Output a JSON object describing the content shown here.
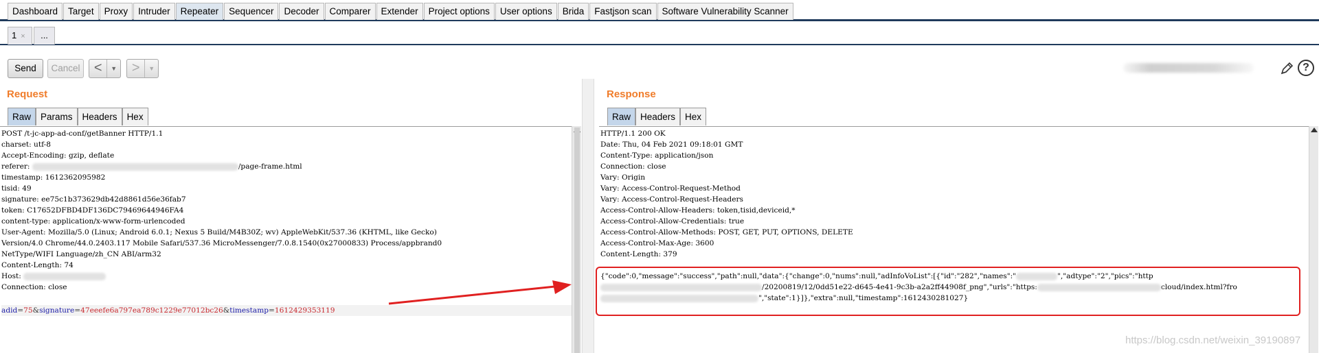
{
  "top_tabs": [
    "Dashboard",
    "Target",
    "Proxy",
    "Intruder",
    "Repeater",
    "Sequencer",
    "Decoder",
    "Comparer",
    "Extender",
    "Project options",
    "User options",
    "Brida",
    "Fastjson scan",
    "Software Vulnerability Scanner"
  ],
  "active_top_tab": "Repeater",
  "sub_tabs": {
    "tab1": "1",
    "close": "×",
    "more": "..."
  },
  "toolbar": {
    "send": "Send",
    "cancel": "Cancel",
    "back": "<",
    "forward": ">",
    "dropdown": "▼",
    "help": "?"
  },
  "request": {
    "title": "Request",
    "tabs": [
      "Raw",
      "Params",
      "Headers",
      "Hex"
    ],
    "lines": [
      "POST /t-jc-app-ad-conf/getBanner HTTP/1.1",
      "charset: utf-8",
      "Accept-Encoding: gzip, deflate",
      "referer: ",
      "timestamp: 1612362095982",
      "tisid: 49",
      "signature: ee75c1b373629db42d8861d56e36fab7",
      "token: C17652DFBD4DF136DC79469644946FA4",
      "content-type: application/x-www-form-urlencoded",
      "User-Agent: Mozilla/5.0 (Linux; Android 6.0.1; Nexus 5 Build/M4B30Z; wv) AppleWebKit/537.36 (KHTML, like Gecko)",
      "Version/4.0 Chrome/44.0.2403.117 Mobile Safari/537.36 MicroMessenger/7.0.8.1540(0x27000833) Process/appbrand0",
      "NetType/WIFI Language/zh_CN ABI/arm32",
      "Content-Length: 74",
      "Host: ",
      "Connection: close"
    ],
    "referer_suffix": "/page-frame.html",
    "body": {
      "k1": "adid",
      "v1": "75",
      "k2": "signature",
      "v2": "47eeefe6a797ea789c1229e77012bc26",
      "k3": "timestamp",
      "v3": "1612429353119",
      "eq": "=",
      "amp": "&"
    }
  },
  "response": {
    "title": "Response",
    "tabs": [
      "Raw",
      "Headers",
      "Hex"
    ],
    "lines": [
      "HTTP/1.1 200 OK",
      "Date: Thu, 04 Feb 2021 09:18:01 GMT",
      "Content-Type: application/json",
      "Connection: close",
      "Vary: Origin",
      "Vary: Access-Control-Request-Method",
      "Vary: Access-Control-Request-Headers",
      "Access-Control-Allow-Headers: token,tisid,deviceid,*",
      "Access-Control-Allow-Credentials: true",
      "Access-Control-Allow-Methods: POST, GET, PUT, OPTIONS, DELETE",
      "Access-Control-Max-Age: 3600",
      "Content-Length: 379"
    ],
    "json_line1_a": "{\"code\":0,\"message\":\"success\",\"path\":null,\"data\":{\"change\":0,\"nums\":null,\"adInfoVoList\":[{\"id\":\"282\",\"names\":\"",
    "json_line1_b": "\",\"adtype\":\"2\",\"pics\":\"http",
    "json_line2_a": "/20200819/12/0dd51e22-d645-4e41-9c3b-a2a2ff44908f_png\",\"urls\":\"https:",
    "json_line2_b": "cloud/index.html?fro",
    "json_line3_a": "\",\"state\":1}]},\"extra\":null,\"timestamp\":1612430281027}"
  },
  "watermark": "https://blog.csdn.net/weixin_39190897",
  "colors": {
    "title_orange": "#f07c2a",
    "annotation_red": "#e02020",
    "param_key": "#1a1aa6",
    "param_value": "#c8282e"
  }
}
